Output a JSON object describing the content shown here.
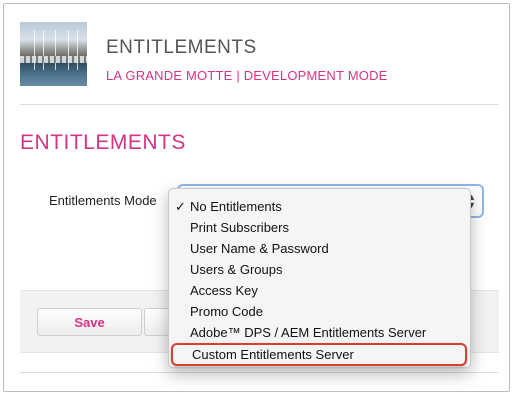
{
  "header": {
    "title": "ENTITLEMENTS",
    "subtitle": "LA GRANDE MOTTE | DEVELOPMENT MODE",
    "thumbnail_icon": "harbor-photo"
  },
  "section": {
    "title": "ENTITLEMENTS"
  },
  "form": {
    "mode_label": "Entitlements Mode",
    "selected_value": "No Entitlements",
    "select_arrows": "▲\n▼"
  },
  "menu": {
    "checkmark": "✓",
    "items": [
      {
        "label": "No Entitlements",
        "checked": true
      },
      {
        "label": "Print Subscribers"
      },
      {
        "label": "User Name & Password"
      },
      {
        "label": "Users & Groups"
      },
      {
        "label": "Access Key"
      },
      {
        "label": "Promo Code"
      },
      {
        "label": "Adobe™ DPS / AEM Entitlements Server"
      },
      {
        "label": "Custom Entitlements Server",
        "highlighted": true
      }
    ]
  },
  "buttons": {
    "save_label": "Save",
    "other_label": ""
  },
  "colors": {
    "accent": "#d63384",
    "highlight_outline": "#d9402b",
    "focus_ring": "#8fb6e7"
  }
}
